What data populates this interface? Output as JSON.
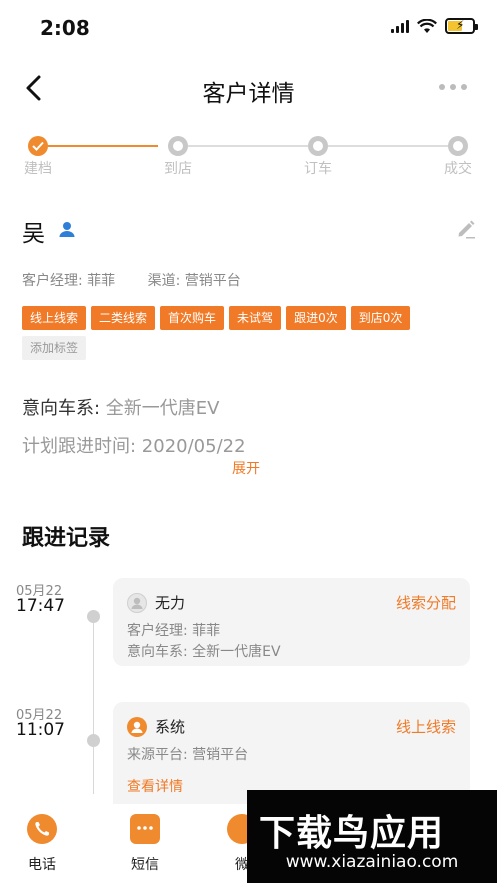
{
  "status_bar": {
    "time": "2:08"
  },
  "nav": {
    "title": "客户详情"
  },
  "steps": [
    {
      "label": "建档",
      "state": "done"
    },
    {
      "label": "到店",
      "state": "todo"
    },
    {
      "label": "订车",
      "state": "todo"
    },
    {
      "label": "成交",
      "state": "todo"
    }
  ],
  "customer": {
    "name": "吴",
    "manager": "客户经理: 菲菲",
    "channel": "渠道: 营销平台",
    "tags": [
      "线上线索",
      "二类线索",
      "首次购车",
      "未试驾",
      "跟进0次",
      "到店0次"
    ],
    "add_tag": "添加标签",
    "intent_key": "意向车系: ",
    "intent_value": "全新一代唐EV",
    "plan": "计划跟进时间: 2020/05/22",
    "expand": "展开"
  },
  "followup": {
    "title": "跟进记录",
    "records": [
      {
        "date": "05月22",
        "time": "17:47",
        "author": "无力",
        "type": "线索分配",
        "lines": [
          "客户经理: 菲菲",
          "意向车系: 全新一代唐EV"
        ]
      },
      {
        "date": "05月22",
        "time": "11:07",
        "author": "系统",
        "type": "线上线索",
        "lines": [
          "来源平台: 营销平台"
        ],
        "link": "查看详情"
      }
    ]
  },
  "tabbar": {
    "items": [
      {
        "label": "电话",
        "icon": "phone-icon"
      },
      {
        "label": "短信",
        "icon": "message-icon"
      },
      {
        "label": "微",
        "icon": "wechat-icon"
      }
    ]
  },
  "watermark": {
    "text": "下载鸟应用",
    "url": "www.xiazainiao.com"
  },
  "colors": {
    "accent": "#f07a27",
    "step_done": "#f08a2e",
    "step_todo": "#c8c8c8"
  }
}
